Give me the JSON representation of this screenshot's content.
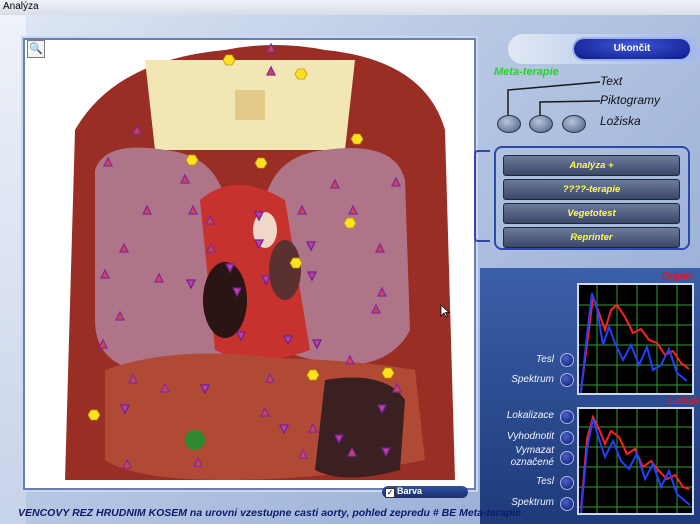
{
  "window": {
    "title": "Analýza"
  },
  "image": {
    "zoom_icon": "magnifier-icon",
    "barva_label": "Barva",
    "barva_checked": true
  },
  "footer": {
    "caption": "VENCOVY REZ HRUDNIM KOSEM  na urovni vzestupne casti aorty, pohled zepredu # BE  Meta-terapie"
  },
  "controls": {
    "exit_label": "Ukončit",
    "meta_label": "Meta-terapie",
    "display_options": [
      "Text",
      "Piktogramy",
      "Ložiska"
    ],
    "menu_buttons": [
      "Analýza +",
      "????-terapie",
      "Vegetotest",
      "Reprinter"
    ]
  },
  "organ_panel": {
    "title": "Orgán",
    "labels": [
      "Tesl",
      "Spektrum"
    ]
  },
  "lesion_panel": {
    "title": "Ložisk",
    "labels": [
      "Lokalizace",
      "Vyhodnotit",
      "Vymazat označené",
      "Tesl",
      "Spektrum"
    ]
  },
  "colors": {
    "marker_triangle": "#7a2ab0",
    "marker_hexagon": "#ffe020",
    "series_red": "#ff2020",
    "series_blue": "#2040ff",
    "grid": "#2fa02f"
  },
  "icons": [
    "magnifier-icon",
    "checkbox-icon",
    "mouse-cursor-icon"
  ]
}
